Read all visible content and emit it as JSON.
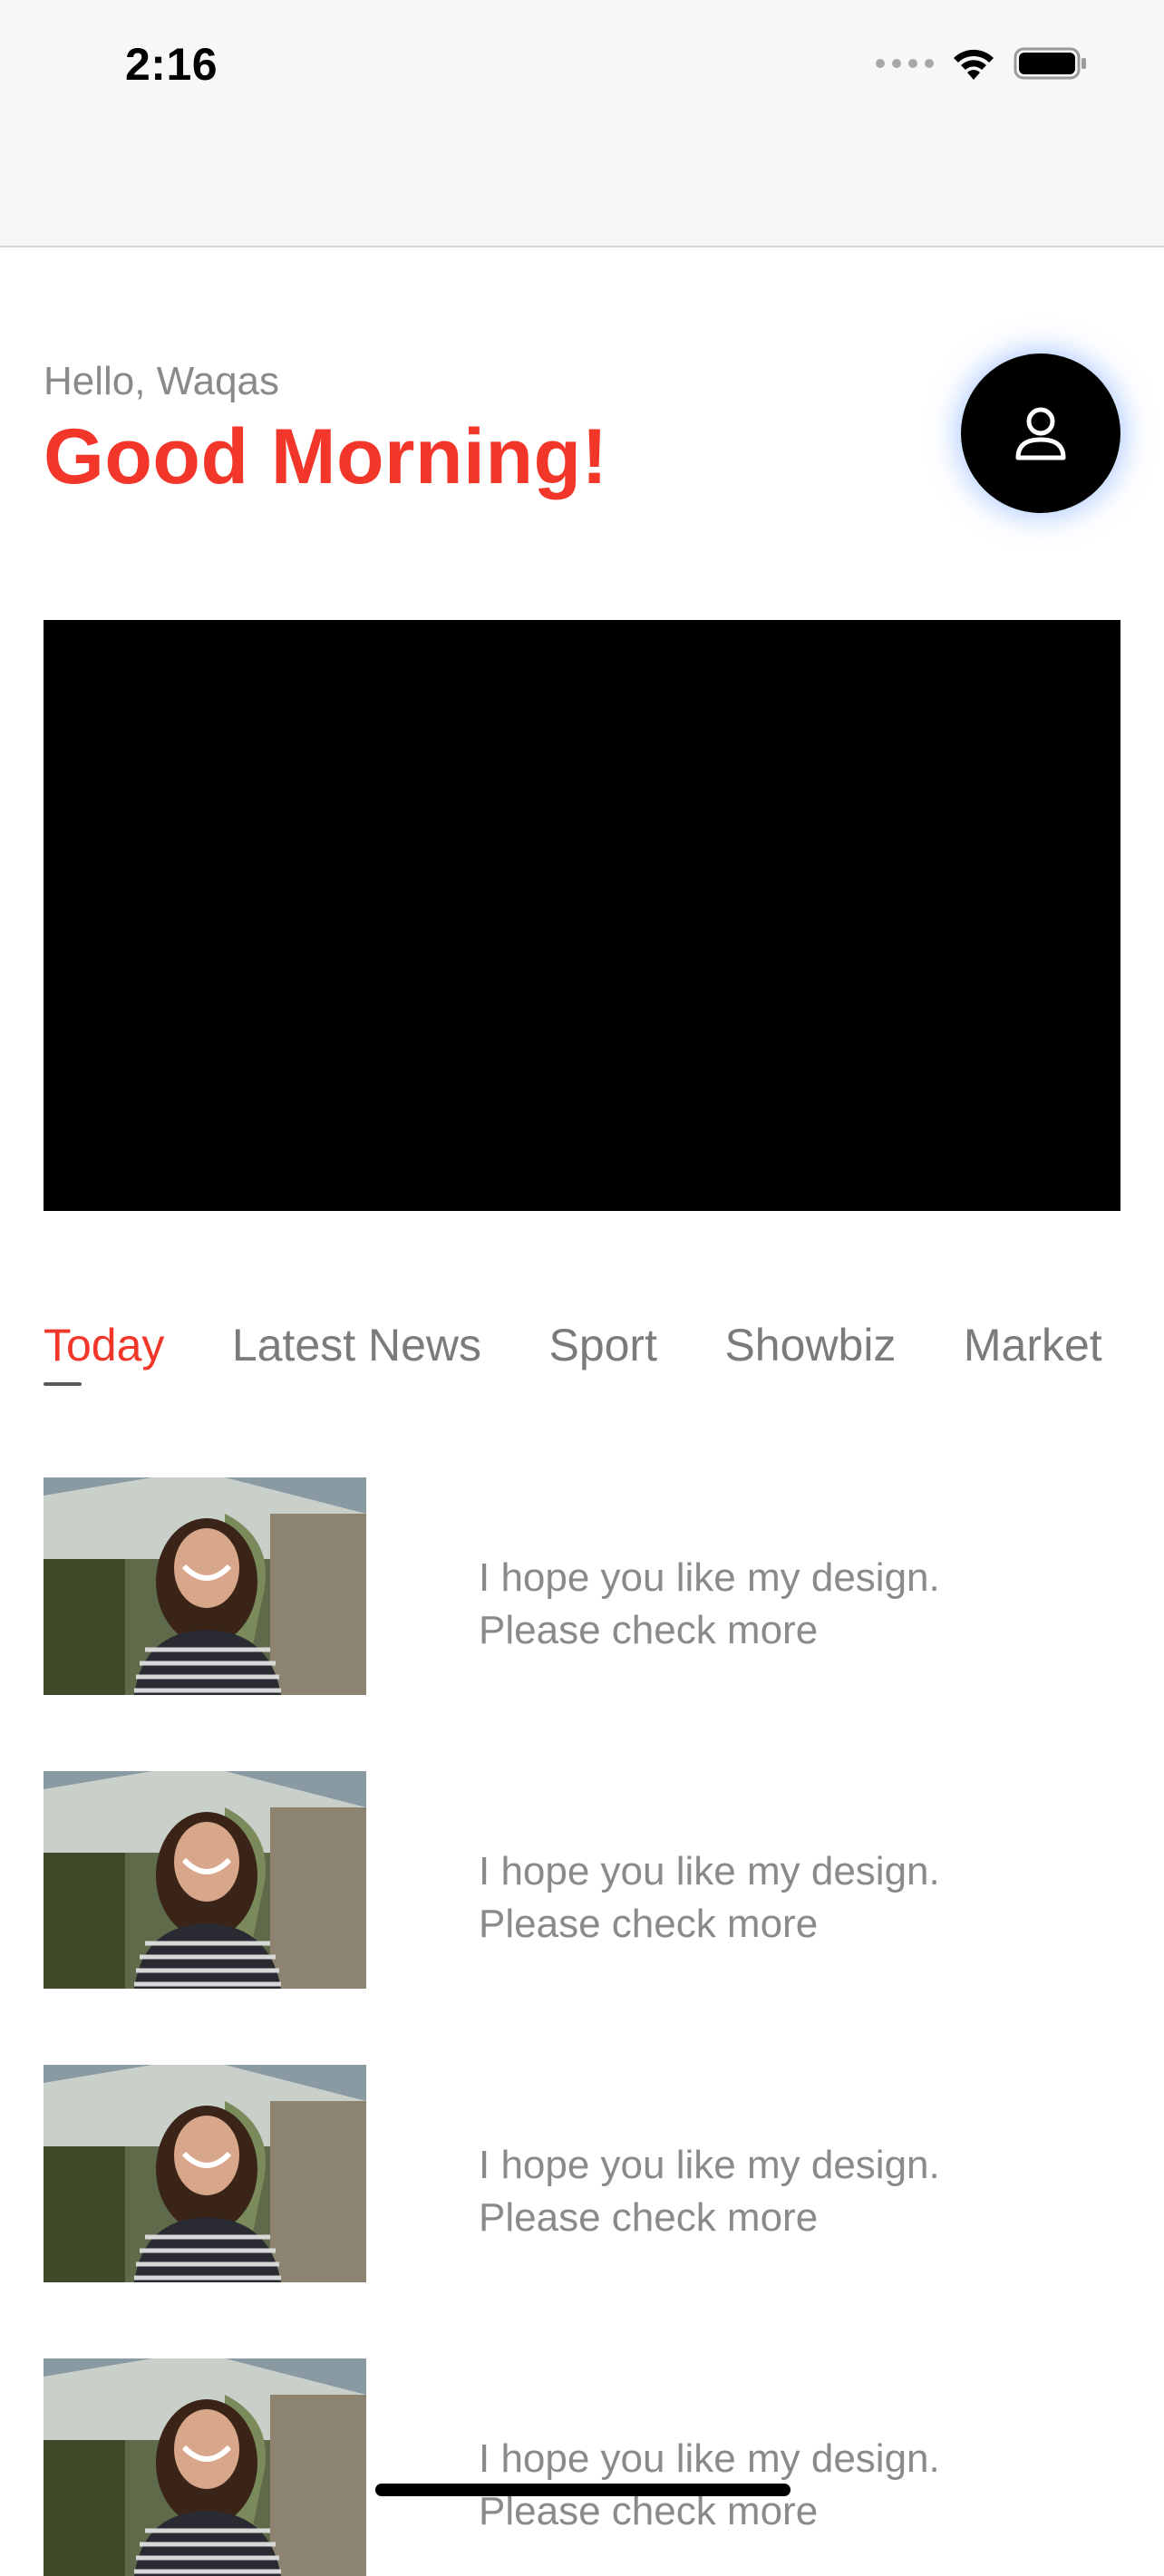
{
  "status_bar": {
    "time": "2:16"
  },
  "header": {
    "hello": "Hello, Waqas",
    "greeting": "Good Morning!"
  },
  "profile": {
    "icon": "person-icon"
  },
  "tabs": [
    {
      "label": "Today",
      "active": true
    },
    {
      "label": "Latest News",
      "active": false
    },
    {
      "label": "Sport",
      "active": false
    },
    {
      "label": "Showbiz",
      "active": false
    },
    {
      "label": "Market",
      "active": false
    }
  ],
  "news_items": [
    {
      "line1": "I hope you like my design.",
      "line2": "Please check more"
    },
    {
      "line1": "I hope you like my design.",
      "line2": "Please check more"
    },
    {
      "line1": "I hope you like my design.",
      "line2": "Please check more"
    },
    {
      "line1": "I hope you like my design.",
      "line2": "Please check more"
    }
  ],
  "colors": {
    "accent": "#f2372a",
    "muted_text": "#8a8a8a"
  }
}
